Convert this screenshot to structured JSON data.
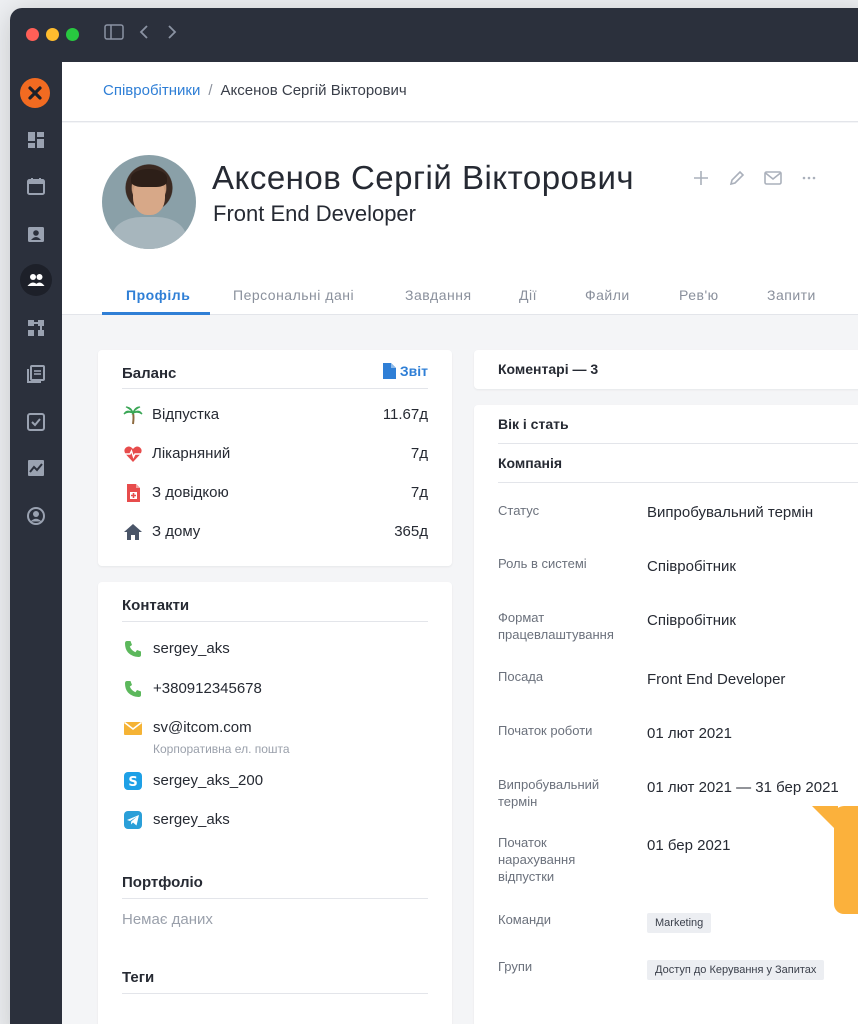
{
  "breadcrumb": {
    "parent": "Співробітники",
    "separator": "/",
    "current": "Аксенов Сергій Вікторович"
  },
  "profile": {
    "name": "Аксенов Сергій Вікторович",
    "role": "Front End Developer"
  },
  "tabs": [
    "Профіль",
    "Персональні дані",
    "Завдання",
    "Дії",
    "Файли",
    "Рев'ю",
    "Запити"
  ],
  "balance": {
    "title": "Баланс",
    "report_label": "Звіт",
    "rows": [
      {
        "label": "Відпустка",
        "value": "11.67д",
        "icon": "palm-tree-icon"
      },
      {
        "label": "Лікарняний",
        "value": "7д",
        "icon": "heartbeat-icon"
      },
      {
        "label": "З довідкою",
        "value": "7д",
        "icon": "medical-document-icon"
      },
      {
        "label": "З дому",
        "value": "365д",
        "icon": "home-icon"
      }
    ]
  },
  "contacts": {
    "title": "Контакти",
    "items": [
      {
        "value": "sergey_aks",
        "icon": "phone-icon"
      },
      {
        "value": "+380912345678",
        "icon": "phone-icon"
      },
      {
        "value": "sv@itcom.com",
        "note": "Корпоративна ел. пошта",
        "icon": "email-icon"
      },
      {
        "value": "sergey_aks_200",
        "icon": "skype-icon"
      },
      {
        "value": "sergey_aks",
        "icon": "telegram-icon"
      }
    ]
  },
  "portfolio": {
    "title": "Портфоліо",
    "empty": "Немає даних"
  },
  "tags": {
    "title": "Теги"
  },
  "comments": {
    "title": "Коментарі — 3"
  },
  "details": {
    "age_gender": "Вік і стать",
    "company": "Компанія",
    "fields": [
      {
        "label": "Статус",
        "value": "Випробувальний термін"
      },
      {
        "label": "Роль в системі",
        "value": "Співробітник"
      },
      {
        "label": "Формат працевлаштування",
        "value": "Співробітник"
      },
      {
        "label": "Посада",
        "value": "Front End Developer"
      },
      {
        "label": "Початок роботи",
        "value": "01 лют 2021"
      },
      {
        "label": "Випробувальний термін",
        "value": "01 лют 2021 — 31 бер 2021"
      },
      {
        "label": "Початок нарахування відпустки",
        "value": "01 бер 2021"
      }
    ],
    "teams_label": "Команди",
    "teams": [
      "Marketing"
    ],
    "groups_label": "Групи",
    "groups": [
      "Доступ до Керування у Запитах"
    ]
  },
  "colors": {
    "accent": "#2f7fd6",
    "sidebar": "#2b303c",
    "logo": "#f26b21",
    "callout": "#fbb13c"
  }
}
